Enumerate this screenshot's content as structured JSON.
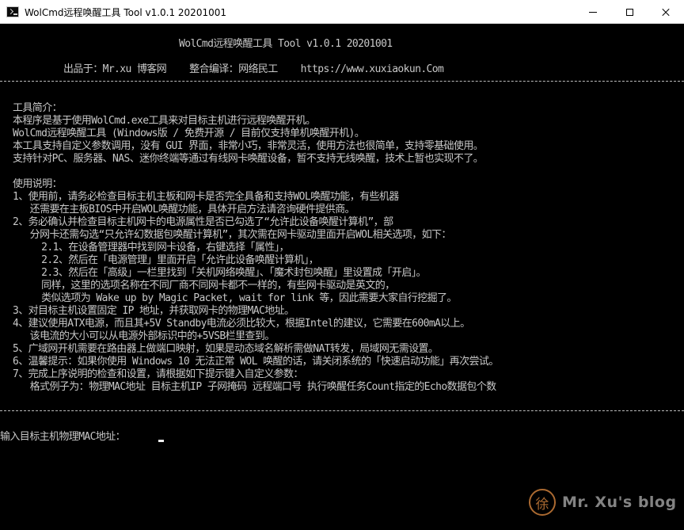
{
  "window": {
    "title": "WolCmd远程唤醒工具 Tool v1.0.1 20201001",
    "icon": "console-icon",
    "controls": [
      "minimize-icon",
      "maximize-icon",
      "close-icon"
    ]
  },
  "console": {
    "header_title": "WolCmd远程唤醒工具 Tool v1.0.1 20201001",
    "header_credits": "出品于：Mr.xu 博客网    整合编译：网络民工    https://www.xuxiaokun.Com",
    "divider": "------------------------------------------------------------------------------------------------------------",
    "intro_heading": "工具简介：",
    "intro_lines": [
      "本程序是基于使用WolCmd.exe工具来对目标主机进行远程唤醒开机。",
      "WolCmd远程唤醒工具 (Windows版 / 免费开源 / 目前仅支持单机唤醒开机)。",
      "本工具支持自定义参数调用，没有 GUI 界面，非常小巧，非常灵活，使用方法也很简单，支持零基础使用。",
      "支持针对PC、服务器、NAS、迷你终端等通过有线网卡唤醒设备，暂不支持无线唤醒，技术上暂也实现不了。"
    ],
    "usage_heading": "使用说明：",
    "usage_lines": [
      "1、使用前，请务必检查目标主机主板和网卡是否完全具备和支持WOL唤醒功能，有些机器",
      "   还需要在主板BIOS中开启WOL唤醒功能，具体开启方法请咨询硬件提供商。",
      "2、务必确认并检查目标主机网卡的电源属性是否已勾选了“允许此设备唤醒计算机”，部",
      "   分网卡还需勾选“只允许幻数据包唤醒计算机”，其次需在网卡驱动里面开启WOL相关选项，如下：",
      "     2.1、在设备管理器中找到网卡设备，右键选择「属性」，",
      "     2.2、然后在「电源管理」里面开启「允许此设备唤醒计算机」，",
      "     2.3、然后在「高级」一栏里找到「关机网络唤醒」、「魔术封包唤醒」里设置成「开启」。",
      "     同样，这里的选项名称在不同厂商不同网卡都不一样的，有些网卡驱动是英文的，",
      "     类似选项为 Wake up by Magic Packet, wait for link 等，因此需要大家自行挖掘了。",
      "3、对目标主机设置固定 IP 地址，并获取网卡的物理MAC地址。",
      "4、建议使用ATX电源，而且其+5V Standby电流必须比较大，根据Intel的建议，它需要在600mA以上。",
      "   该电流的大小可以从电源外部标识中的+5VSB栏里查到。",
      "5、广域网开机需要在路由器上做端口映射，如果是动态域名解析需做NAT转发，局域网无需设置。",
      "6、温馨提示：如果你使用 Windows 10 无法正常 WOL 唤醒的话，请关闭系统的「快速启动功能」再次尝试。",
      "7、完成上序说明的检查和设置，请根据如下提示键入自定义参数：",
      "   格式例子为：物理MAC地址 目标主机IP 子网掩码 远程端口号 执行唤醒任务Count指定的Echo数据包个数"
    ],
    "prompt_label": "输入目标主机物理MAC地址："
  },
  "watermark": {
    "logo_glyph": "徐",
    "text": "Mr. Xu's blog",
    "logo_color": "#c97d3a",
    "text_color": "#9a9a9a"
  },
  "colors": {
    "console_background": "#000000",
    "console_text": "#c8c8c8",
    "titlebar_background": "#ffffff"
  }
}
